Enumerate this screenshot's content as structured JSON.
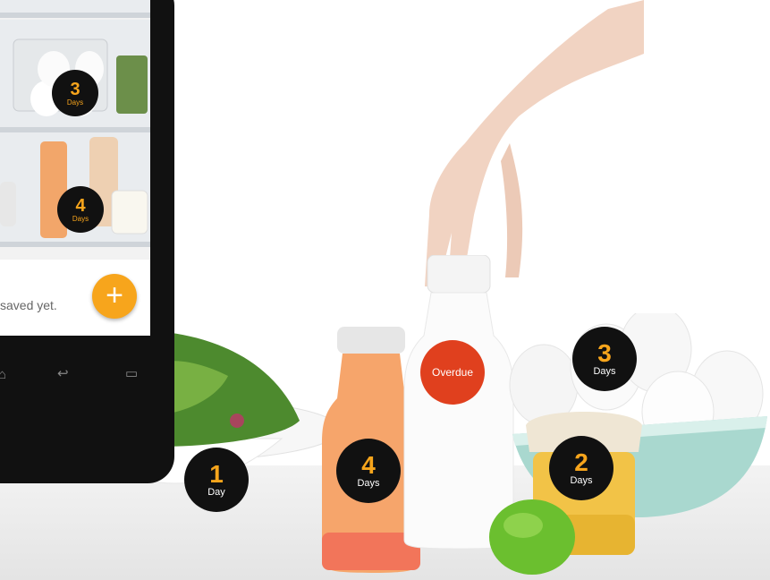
{
  "phone": {
    "saved_text": "saved yet.",
    "fab_label": "+",
    "badges": [
      {
        "num": "3",
        "label": "Days"
      },
      {
        "num": "4",
        "label": "Days"
      }
    ]
  },
  "food_badges": [
    {
      "num": "1",
      "label": "Day"
    },
    {
      "num": "4",
      "label": "Days"
    },
    {
      "label": "Overdue"
    },
    {
      "num": "3",
      "label": "Days"
    },
    {
      "num": "2",
      "label": "Days"
    }
  ],
  "colors": {
    "accent": "#f7a51c",
    "badge_bg": "#111111",
    "overdue": "#e0401e"
  },
  "icons": {
    "fab": "plus-icon",
    "nav_home": "home-icon",
    "nav_back": "back-arrow-icon",
    "nav_recent": "recent-apps-icon"
  }
}
